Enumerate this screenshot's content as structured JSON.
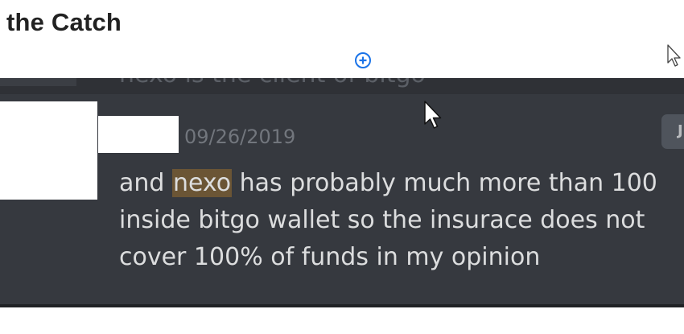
{
  "page": {
    "heading": "the Catch",
    "add_icon": "plus-circle-icon",
    "cursor_icon": "pointer-cursor-icon"
  },
  "previous_message": {
    "text": "nexo is the client of bitgo"
  },
  "message": {
    "timestamp": "09/26/2019",
    "tag": "Jun",
    "line1_before": "and ",
    "line1_highlight": "nexo",
    "line1_after": " has probably much more than 100",
    "line2": "inside bitgo wallet so the insurace does not",
    "line3": "cover 100% of funds in my opinion"
  },
  "colors": {
    "background": "#36393f",
    "text": "#dcddde",
    "timestamp": "#72767d",
    "highlight": "#6b5535",
    "add_icon": "#1a73e8"
  }
}
